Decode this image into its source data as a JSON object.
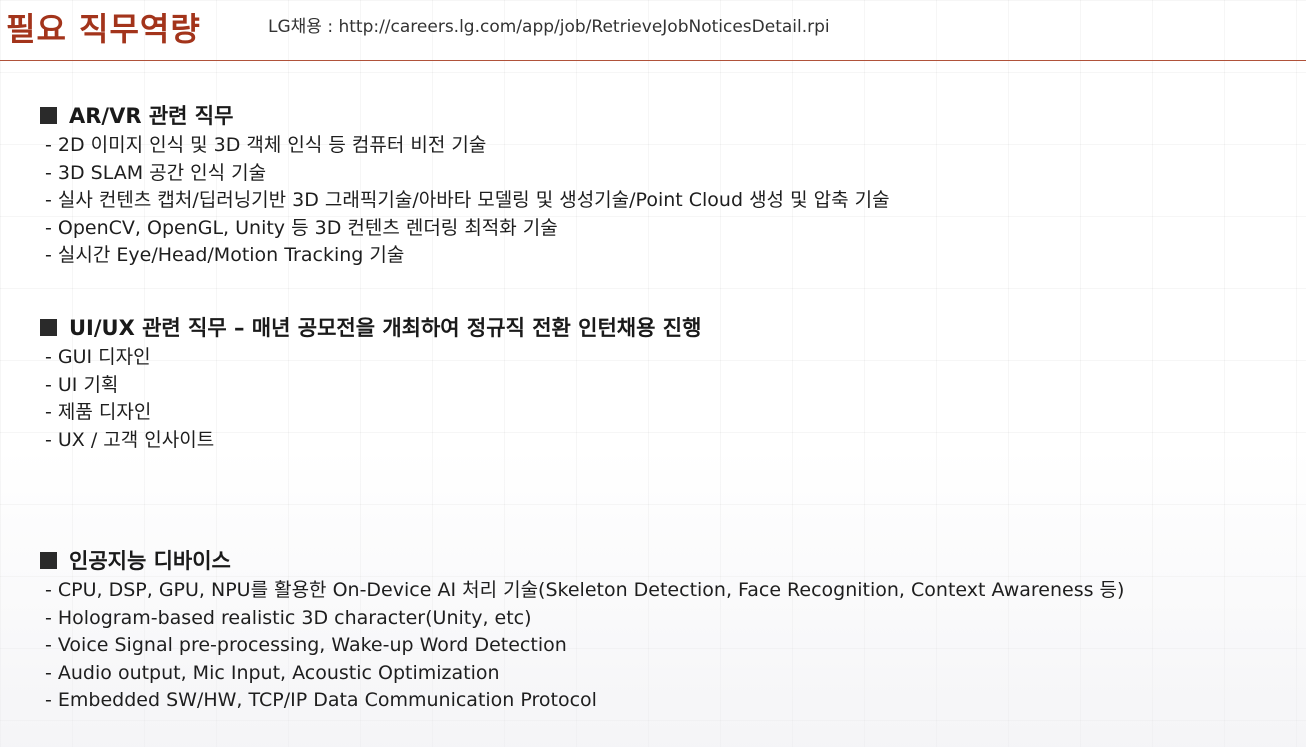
{
  "header": {
    "title": "필요 직무역량",
    "source": "LG채용 : http://careers.lg.com/app/job/RetrieveJobNoticesDetail.rpi"
  },
  "sections": [
    {
      "heading": "AR/VR 관련 직무",
      "items": [
        "- 2D 이미지 인식 및 3D 객체 인식 등 컴퓨터 비전 기술",
        "- 3D SLAM 공간 인식 기술",
        "- 실사 컨텐츠 캡처/딥러닝기반 3D 그래픽기술/아바타 모델링 및 생성기술/Point Cloud 생성 및 압축 기술",
        "- OpenCV, OpenGL, Unity 등 3D 컨텐츠 렌더링 최적화 기술",
        "- 실시간 Eye/Head/Motion Tracking 기술"
      ]
    },
    {
      "heading": "UI/UX 관련 직무 – 매년 공모전을 개최하여 정규직 전환 인턴채용 진행",
      "items": [
        "- GUI 디자인",
        "- UI 기획",
        "- 제품 디자인",
        "- UX / 고객 인사이트"
      ]
    },
    {
      "heading": "인공지능 디바이스",
      "items": [
        "- CPU, DSP, GPU, NPU를 활용한 On-Device AI 처리 기술(Skeleton Detection, Face Recognition, Context Awareness 등)",
        "- Hologram-based realistic 3D character(Unity, etc)",
        "- Voice Signal pre-processing, Wake-up Word Detection",
        "- Audio output, Mic Input, Acoustic Optimization",
        "- Embedded SW/HW, TCP/IP Data Communication Protocol"
      ]
    }
  ],
  "colors": {
    "title": "#a3341b",
    "rule": "#b0523a",
    "text": "#1a1a1a"
  }
}
